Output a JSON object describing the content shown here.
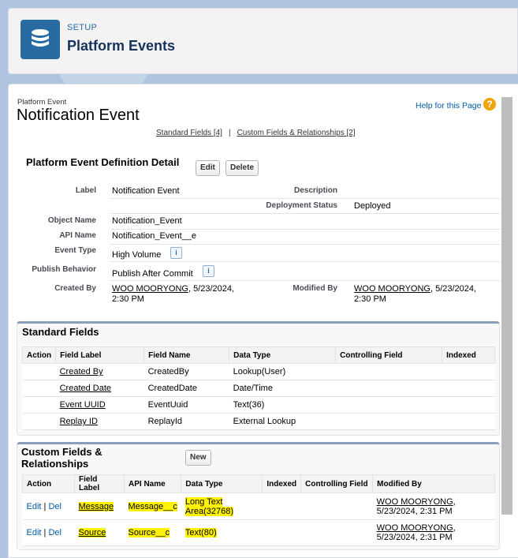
{
  "header": {
    "setup_label": "SETUP",
    "title": "Platform Events",
    "icon": "database-icon"
  },
  "page": {
    "type_label": "Platform Event",
    "title": "Notification Event",
    "help_link": "Help for this Page",
    "std_fields_link": "Standard Fields",
    "std_fields_count": "[4]",
    "custom_fields_link": "Custom Fields & Relationships",
    "custom_fields_count": "[2]",
    "separator": "|"
  },
  "detail": {
    "title": "Platform Event Definition Detail",
    "edit_label": "Edit",
    "delete_label": "Delete",
    "label_lbl": "Label",
    "label_val": "Notification Event",
    "desc_lbl": "Description",
    "desc_val": "",
    "deploy_lbl": "Deployment Status",
    "deploy_val": "Deployed",
    "obj_lbl": "Object Name",
    "obj_val": "Notification_Event",
    "api_lbl": "API Name",
    "api_val": "Notification_Event__e",
    "etype_lbl": "Event Type",
    "etype_val": "High Volume",
    "pub_lbl": "Publish Behavior",
    "pub_val": "Publish After Commit",
    "created_lbl": "Created By",
    "created_user": "WOO MOORYONG",
    "created_date": ", 5/23/2024,",
    "created_time": "2:30 PM",
    "modified_lbl": "Modified By",
    "modified_user": "WOO MOORYONG",
    "modified_date": ", 5/23/2024,",
    "modified_time": "2:30 PM"
  },
  "standard_fields": {
    "title": "Standard Fields",
    "columns": [
      "Action",
      "Field Label",
      "Field Name",
      "Data Type",
      "Controlling Field",
      "Indexed"
    ],
    "rows": [
      {
        "label": "Created By",
        "name": "CreatedBy",
        "type": "Lookup(User)"
      },
      {
        "label": "Created Date",
        "name": "CreatedDate",
        "type": "Date/Time"
      },
      {
        "label": "Event UUID",
        "name": "EventUuid",
        "type": "Text(36)"
      },
      {
        "label": "Replay ID",
        "name": "ReplayId",
        "type": "External Lookup"
      }
    ]
  },
  "custom_fields": {
    "title": "Custom Fields & Relationships",
    "new_label": "New",
    "columns": [
      "Action",
      "Field Label",
      "API Name",
      "Data Type",
      "Indexed",
      "Controlling Field",
      "Modified By"
    ],
    "edit": "Edit",
    "del": "Del",
    "pipe": "|",
    "rows": [
      {
        "label": "Message",
        "api": "Message__c",
        "type": "Long Text Area(32768)",
        "user": "WOO MOORYONG",
        "date": ",",
        "date2": "5/23/2024, 2:31 PM"
      },
      {
        "label": "Source",
        "api": "Source__c",
        "type": "Text(80)",
        "user": "WOO MOORYONG",
        "date": ",",
        "date2": "5/23/2024, 2:31 PM"
      }
    ]
  },
  "colors": {
    "accent": "#2a6aa3",
    "highlight": "#fff200",
    "link": "#015ba7"
  }
}
